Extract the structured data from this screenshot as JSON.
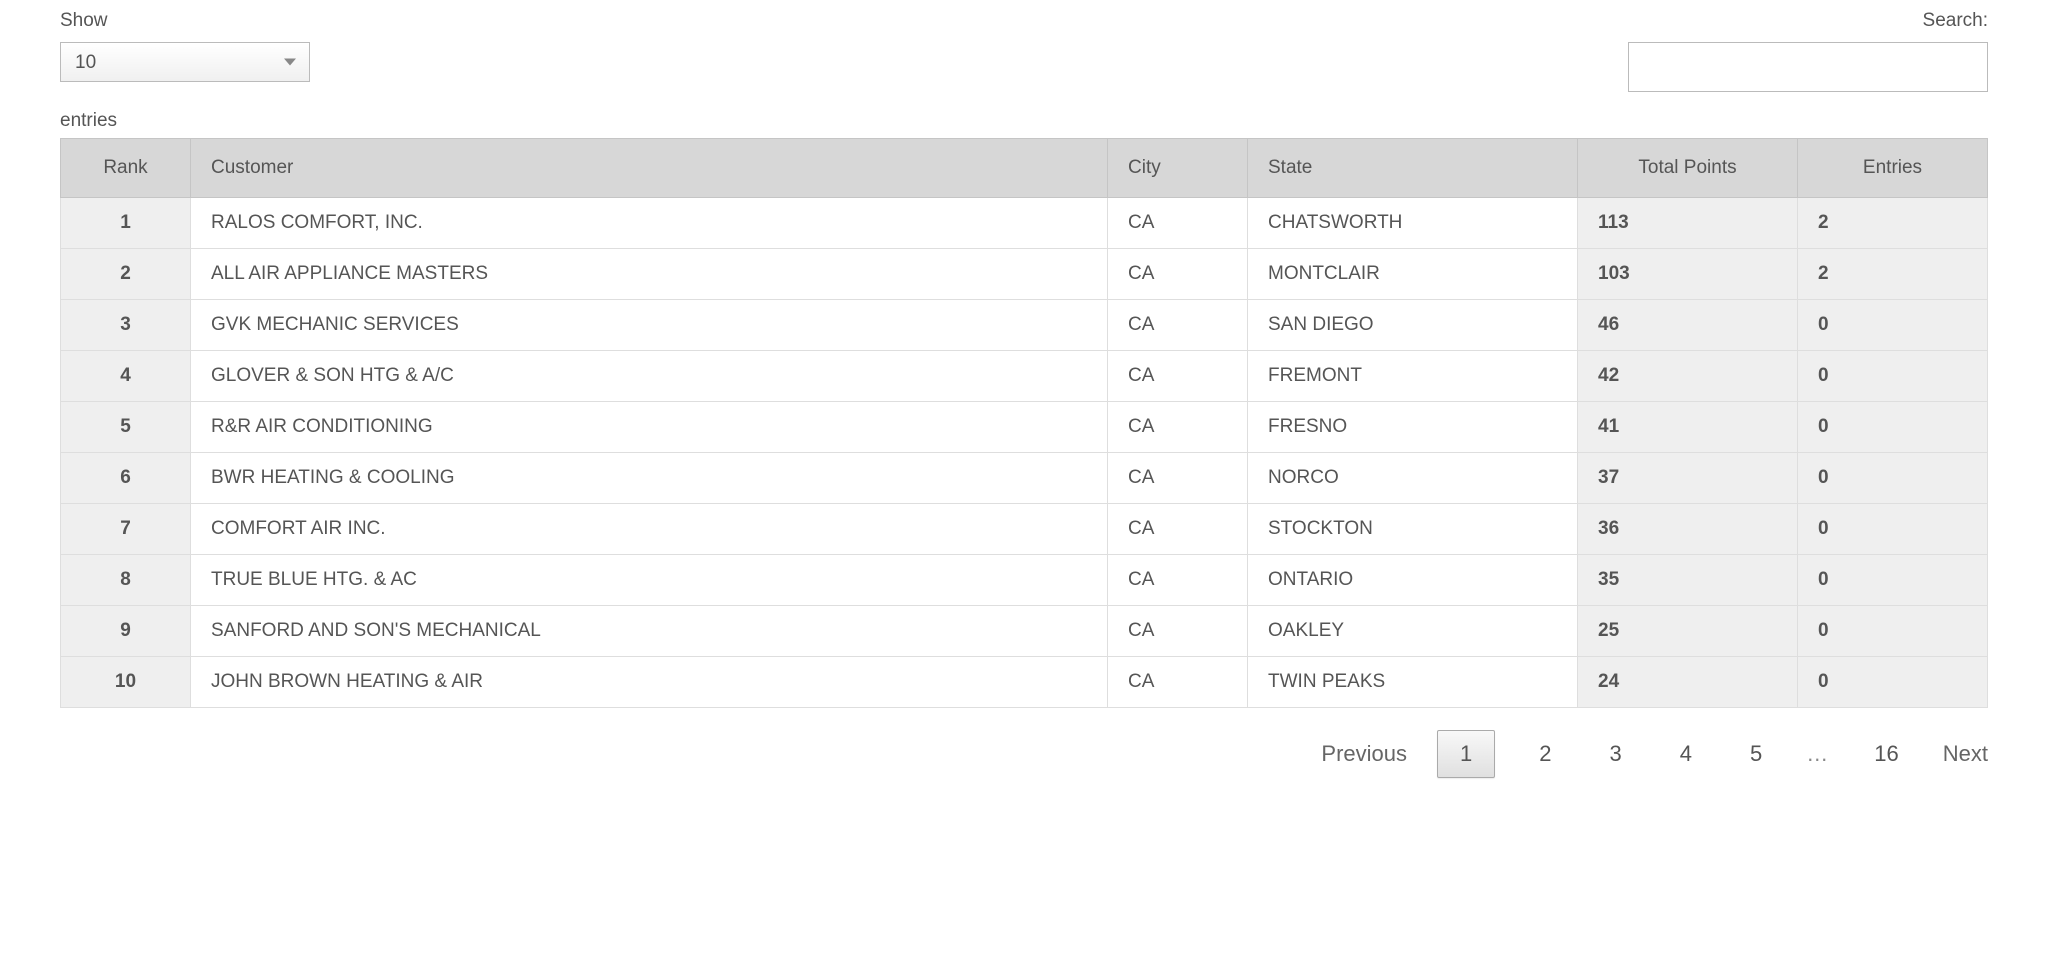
{
  "controls": {
    "show_label": "Show",
    "show_value": "10",
    "search_label": "Search:",
    "search_value": "",
    "entries_label": "entries"
  },
  "table": {
    "headers": {
      "rank": "Rank",
      "customer": "Customer",
      "city": "City",
      "state": "State",
      "total_points": "Total Points",
      "entries": "Entries"
    },
    "rows": [
      {
        "rank": "1",
        "customer": "RALOS COMFORT, INC.",
        "city": "CA",
        "state": "CHATSWORTH",
        "total_points": "113",
        "entries": "2"
      },
      {
        "rank": "2",
        "customer": "ALL AIR APPLIANCE MASTERS",
        "city": "CA",
        "state": "MONTCLAIR",
        "total_points": "103",
        "entries": "2"
      },
      {
        "rank": "3",
        "customer": "GVK MECHANIC SERVICES",
        "city": "CA",
        "state": "SAN DIEGO",
        "total_points": "46",
        "entries": "0"
      },
      {
        "rank": "4",
        "customer": "GLOVER & SON HTG & A/C",
        "city": "CA",
        "state": "FREMONT",
        "total_points": "42",
        "entries": "0"
      },
      {
        "rank": "5",
        "customer": "R&R AIR CONDITIONING",
        "city": "CA",
        "state": "FRESNO",
        "total_points": "41",
        "entries": "0"
      },
      {
        "rank": "6",
        "customer": "BWR HEATING & COOLING",
        "city": "CA",
        "state": "NORCO",
        "total_points": "37",
        "entries": "0"
      },
      {
        "rank": "7",
        "customer": "COMFORT AIR INC.",
        "city": "CA",
        "state": "STOCKTON",
        "total_points": "36",
        "entries": "0"
      },
      {
        "rank": "8",
        "customer": "TRUE BLUE HTG. & AC",
        "city": "CA",
        "state": "ONTARIO",
        "total_points": "35",
        "entries": "0"
      },
      {
        "rank": "9",
        "customer": "SANFORD AND SON'S MECHANICAL",
        "city": "CA",
        "state": "OAKLEY",
        "total_points": "25",
        "entries": "0"
      },
      {
        "rank": "10",
        "customer": "JOHN BROWN HEATING & AIR",
        "city": "CA",
        "state": "TWIN PEAKS",
        "total_points": "24",
        "entries": "0"
      }
    ]
  },
  "pagination": {
    "previous": "Previous",
    "next": "Next",
    "pages": [
      "1",
      "2",
      "3",
      "4",
      "5"
    ],
    "ellipsis": "…",
    "last": "16",
    "current": "1"
  }
}
